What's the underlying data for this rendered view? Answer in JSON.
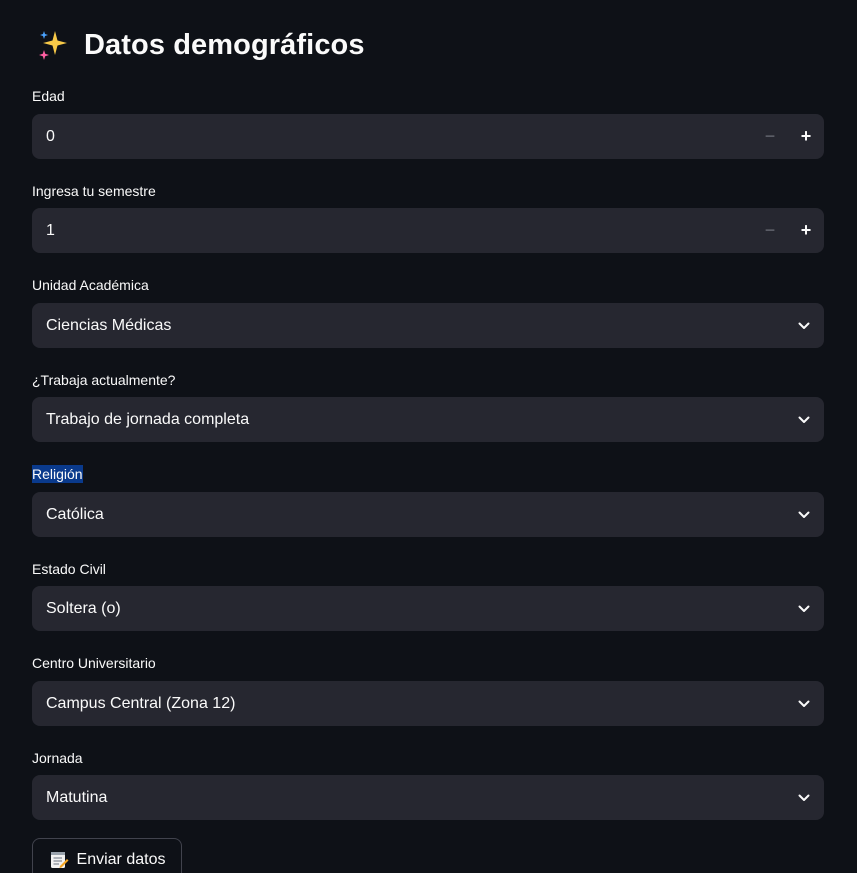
{
  "title": {
    "icon": "sparkles-icon",
    "text": "Datos demográficos"
  },
  "fields": {
    "edad": {
      "label": "Edad",
      "value": "0",
      "minus": "−",
      "plus": "+"
    },
    "semestre": {
      "label": "Ingresa tu semestre",
      "value": "1",
      "minus": "−",
      "plus": "+"
    },
    "unidad": {
      "label": "Unidad Académica",
      "value": "Ciencias Médicas"
    },
    "trabaja": {
      "label": "¿Trabaja actualmente?",
      "value": "Trabajo de jornada completa"
    },
    "religion": {
      "label": "Religión",
      "value": "Católica"
    },
    "estado_civil": {
      "label": "Estado Civil",
      "value": "Soltera (o)"
    },
    "centro": {
      "label": "Centro Universitario",
      "value": "Campus Central (Zona 12)"
    },
    "jornada": {
      "label": "Jornada",
      "value": "Matutina"
    }
  },
  "submit": {
    "icon": "memo-icon",
    "label": "Enviar datos"
  },
  "colors": {
    "background": "#0e1117",
    "control_bg": "#262730",
    "text": "#fafafa",
    "label_highlight": "#0a3a8c"
  }
}
